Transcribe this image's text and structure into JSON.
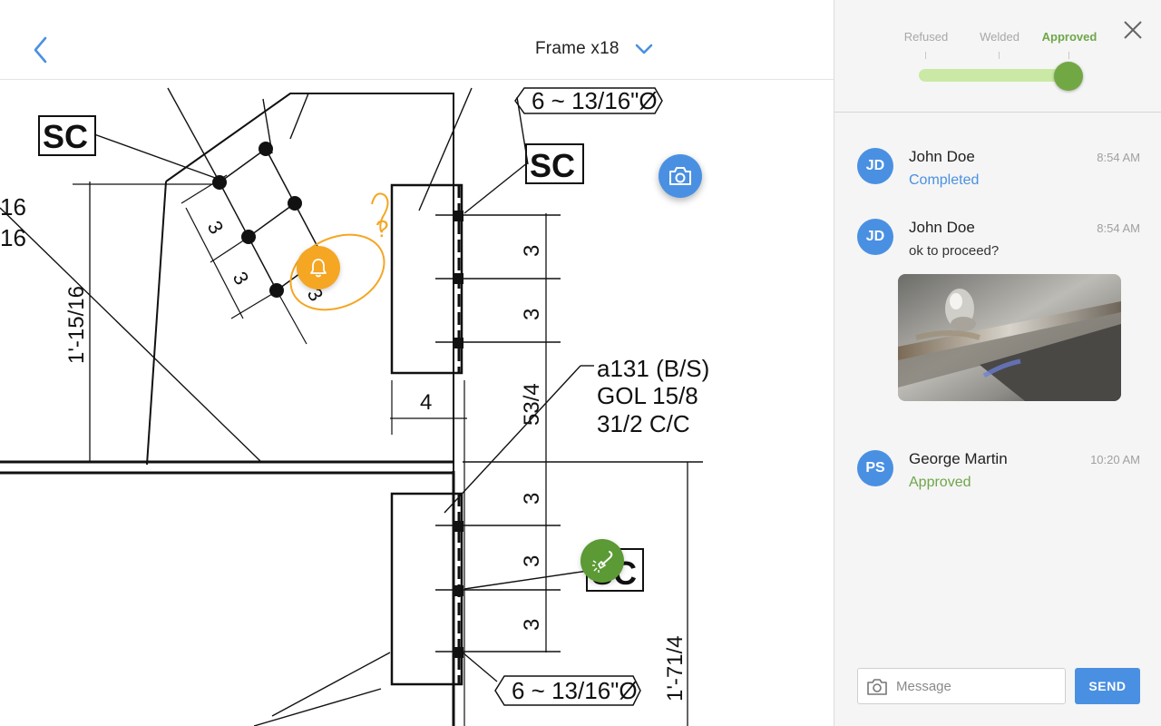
{
  "header": {
    "frame_title": "Frame x18",
    "back_icon": "chevron-left-icon",
    "dropdown_icon": "chevron-down-icon"
  },
  "drawing": {
    "callouts": {
      "sc_top_left": "SC",
      "sc_right": "SC",
      "sc_bottom": "SC",
      "bolt_top": "6 ~ 13/16\"Ø",
      "bolt_bottom": "6 ~ 13/16\"Ø",
      "spec_line1": "a131 (B/S)",
      "spec_line2": "GOL 15/8",
      "spec_line3": "31/2 C/C",
      "dim_3": "3",
      "dim_4": "4",
      "dim_534": "53/4",
      "dim_vert_left": "1'-15/16",
      "dim_vert_right": "1'-71/4",
      "dim_16a": "16",
      "dim_16b": "16",
      "question_mark": "?"
    },
    "markers": {
      "camera": "camera-icon",
      "bell": "bell-icon",
      "weld": "welding-torch-icon"
    }
  },
  "status": {
    "steps": [
      "Refused",
      "Welded",
      "Approved"
    ],
    "current_step": "Approved",
    "progress_fraction": 1.0,
    "accent_green": "#6fa64a",
    "track_green": "#c9e9a4"
  },
  "messages": [
    {
      "initials": "JD",
      "name": "John Doe",
      "time": "8:54 AM",
      "body": "Completed",
      "body_style": "blue"
    },
    {
      "initials": "JD",
      "name": "John Doe",
      "time": "8:54 AM",
      "body": "ok to proceed?",
      "body_style": "plain",
      "has_photo": true
    },
    {
      "initials": "PS",
      "name": "George Martin",
      "time": "10:20 AM",
      "body": "Approved",
      "body_style": "green"
    }
  ],
  "composer": {
    "placeholder": "Message",
    "send_label": "SEND",
    "camera_icon": "camera-icon"
  },
  "colors": {
    "primary_blue": "#4a90e2",
    "bell_orange": "#f5a623",
    "weld_green": "#5b9a35"
  }
}
